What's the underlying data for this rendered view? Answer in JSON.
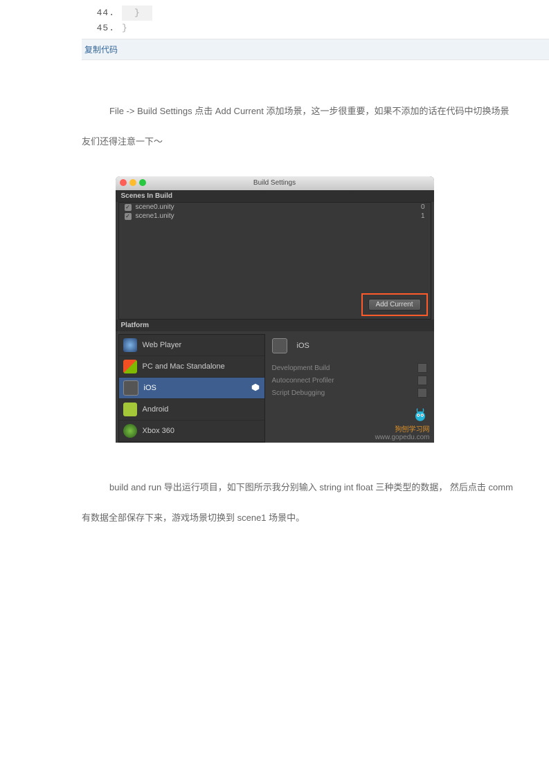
{
  "code": {
    "lines": [
      {
        "num": "44.",
        "text": "}",
        "highlight": true
      },
      {
        "num": "45.",
        "text": "}",
        "highlight": false
      }
    ],
    "copy_label": "复制代码"
  },
  "para1_prefix": "File -> Build Settings  点击 Add Current 添加场景，这一步很重要，如果不添加的话在代码中切换场景",
  "para1_line2": "友们还得注意一下～",
  "para2_prefix": "build and run  导出运行项目，如下图所示我分别输入 string int float  三种类型的数据， 然后点击 comm",
  "para2_line2": "有数据全部保存下来，游戏场景切换到 scene1 场景中。",
  "build_settings": {
    "title": "Build Settings",
    "scenes_label": "Scenes In Build",
    "scenes": [
      {
        "name": "scene0.unity",
        "index": "0"
      },
      {
        "name": "scene1.unity",
        "index": "1"
      }
    ],
    "add_current": "Add Current",
    "platform_label": "Platform",
    "platforms": {
      "web": "Web Player",
      "pcmac": "PC and Mac Standalone",
      "ios": "iOS",
      "android": "Android",
      "xbox": "Xbox 360"
    },
    "right": {
      "ios_header": "iOS",
      "dev_build": "Development Build",
      "autoconnect": "Autoconnect Profiler",
      "script_debug": "Script Debugging"
    },
    "watermark": {
      "line1": "狗刨学习网",
      "line2": "www.gopedu.com"
    }
  }
}
